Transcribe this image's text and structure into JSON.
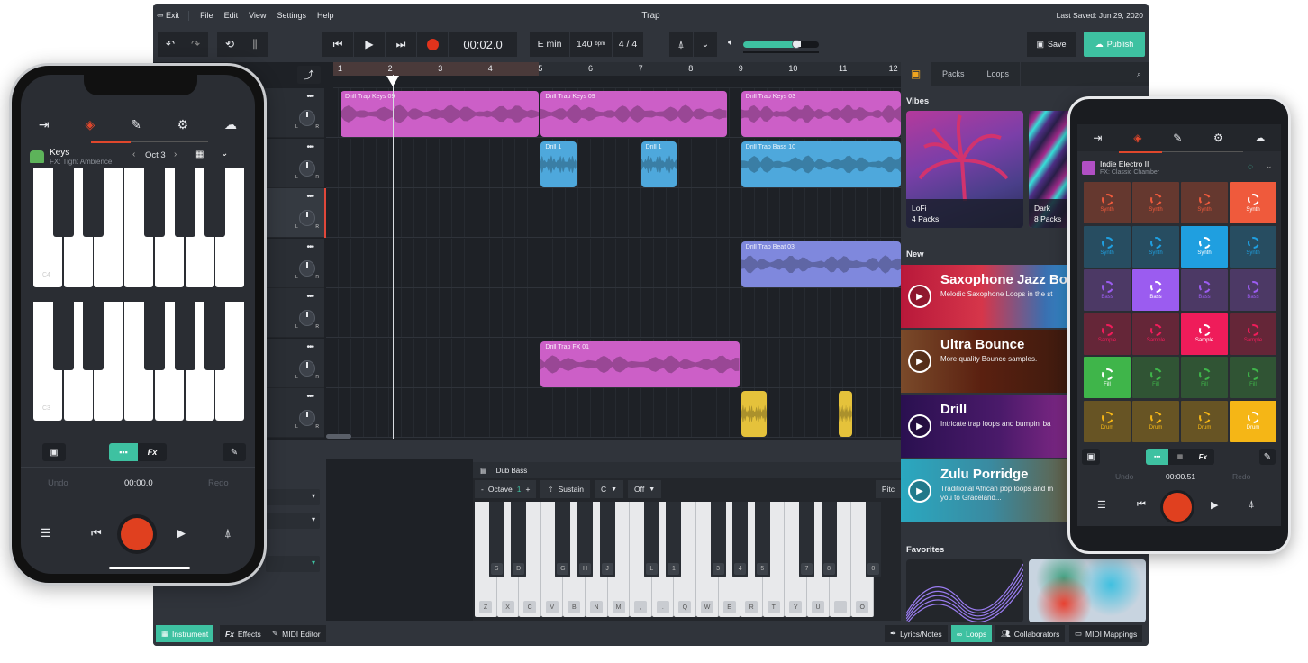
{
  "app": {
    "title": "Trap",
    "last_saved": "Last Saved: Jun 29, 2020",
    "menu": [
      "Exit",
      "File",
      "Edit",
      "View",
      "Settings",
      "Help"
    ]
  },
  "toolbar": {
    "time": "00:02.0",
    "key": "E min",
    "bpm": "140",
    "bpm_unit": "bpm",
    "signature": "4 / 4",
    "volume": 0.7,
    "save_label": "Save",
    "publish_label": "Publish"
  },
  "ruler": {
    "bars": [
      "1",
      "2",
      "3",
      "4",
      "5",
      "6",
      "7",
      "8",
      "9",
      "10",
      "11",
      "12"
    ],
    "loop_bars": [
      1,
      5
    ],
    "playhead_bar": 2.05
  },
  "tracks": [
    {
      "clips": [
        {
          "name": "Drill Trap Keys 09",
          "start": 1,
          "end": 5,
          "color": "#cc5fc7"
        },
        {
          "name": "Drill Trap Keys 09",
          "start": 5,
          "end": 8.75,
          "color": "#cc5fc7"
        },
        {
          "name": "Drill Trap Keys 03",
          "start": 9,
          "end": 12.3,
          "color": "#cc5fc7"
        }
      ]
    },
    {
      "clips": [
        {
          "name": "Drill 1",
          "start": 5,
          "end": 5.75,
          "color": "#4ea8dc"
        },
        {
          "name": "Drill 1",
          "start": 7,
          "end": 7.75,
          "color": "#4ea8dc"
        },
        {
          "name": "Drill Trap Bass 10",
          "start": 9,
          "end": 12.3,
          "color": "#4ea8dc"
        }
      ]
    },
    {
      "clips": [],
      "selected": true
    },
    {
      "clips": [
        {
          "name": "Drill Trap Beat 03",
          "start": 9,
          "end": 12.3,
          "color": "#7f88dd"
        }
      ]
    },
    {
      "clips": []
    },
    {
      "clips": [
        {
          "name": "Drill Trap FX 01",
          "start": 5,
          "end": 9,
          "color": "#cc5fc7"
        }
      ]
    },
    {
      "clips": [
        {
          "name": "",
          "start": 9,
          "end": 9.55,
          "color": "#e5c23b"
        },
        {
          "name": "",
          "start": 10.95,
          "end": 11.25,
          "color": "#e5c23b"
        }
      ]
    }
  ],
  "keyboard_panel": {
    "instrument": "Dub Bass",
    "octave_label": "Octave",
    "octave_value": "1",
    "minus": "-",
    "plus": "+",
    "sustain": "Sustain",
    "key_select": "C",
    "mode_select": "Off",
    "pitch_label": "Pitc",
    "white_keys": [
      "Z",
      "X",
      "C",
      "V",
      "B",
      "N",
      "M",
      ",",
      ".",
      "Q",
      "W",
      "E",
      "R",
      "T",
      "Y",
      "U",
      "I",
      "O"
    ],
    "black_keys": [
      {
        "after": 0,
        "label": "S"
      },
      {
        "after": 1,
        "label": "D"
      },
      {
        "after": 3,
        "label": "G"
      },
      {
        "after": 4,
        "label": "H"
      },
      {
        "after": 5,
        "label": "J"
      },
      {
        "after": 7,
        "label": "L"
      },
      {
        "after": 8,
        "label": "1"
      },
      {
        "after": 10,
        "label": "3"
      },
      {
        "after": 11,
        "label": "4"
      },
      {
        "after": 12,
        "label": "5"
      },
      {
        "after": 14,
        "label": "7"
      },
      {
        "after": 15,
        "label": "8"
      },
      {
        "after": 17,
        "label": "0"
      }
    ]
  },
  "bottom_tabs_left": [
    {
      "label": "Instrument",
      "active": true
    },
    {
      "label": "Effects",
      "active": false
    },
    {
      "label": "MIDI Editor",
      "active": false
    }
  ],
  "bottom_tabs_right": [
    {
      "label": "Lyrics/Notes",
      "active": false
    },
    {
      "label": "Loops",
      "active": true
    },
    {
      "label": "Collaborators",
      "active": false
    },
    {
      "label": "MIDI Mappings",
      "active": false
    }
  ],
  "browser": {
    "tabs": [
      "Packs",
      "Loops"
    ],
    "vibes_heading": "Vibes",
    "vibes": [
      {
        "name": "LoFi",
        "count": "4 Packs"
      },
      {
        "name": "Dark",
        "count": "8 Packs"
      }
    ],
    "new_heading": "New",
    "new_items": [
      {
        "title": "Saxophone Jazz Bop",
        "subtitle": "Melodic Saxophone Loops in the st"
      },
      {
        "title": "Ultra Bounce",
        "subtitle": "More quality Bounce samples."
      },
      {
        "title": "Drill",
        "subtitle": "Intricate trap loops and bumpin' ba"
      },
      {
        "title": "Zulu Porridge",
        "subtitle": "Traditional African pop loops and m\nyou to Graceland..."
      }
    ],
    "favorites_heading": "Favorites"
  },
  "iphone": {
    "instrument": "Keys",
    "fx": "FX: Tight Ambience",
    "octave": "Oct 3",
    "key_labels": [
      "C4",
      "C3"
    ],
    "fx_label": "Fx",
    "undo": "Undo",
    "redo": "Redo",
    "time": "00:00.0"
  },
  "android": {
    "instrument": "Indie Electro II",
    "fx": "FX: Classic Chamber",
    "pads": [
      {
        "label": "Synth",
        "color": "#ef5a3c",
        "active_index": 3
      },
      {
        "label": "Synth",
        "color": "#1f9fe0",
        "active_index": 2
      },
      {
        "label": "Bass",
        "color": "#9b5cf0",
        "active_index": 1
      },
      {
        "label": "Sample",
        "color": "#ef1c5a",
        "active_index": 2
      },
      {
        "label": "Fill",
        "color": "#3fb54a",
        "active_index": 0
      },
      {
        "label": "Drum",
        "color": "#f5b616",
        "active_index": 3
      }
    ],
    "fx_label": "Fx",
    "undo": "Undo",
    "redo": "Redo",
    "time": "00:00.51"
  },
  "colors": {
    "accent": "#3ec1a1",
    "record": "#e0331c",
    "bg": "#30343b",
    "tab_active": "#e0472c"
  }
}
